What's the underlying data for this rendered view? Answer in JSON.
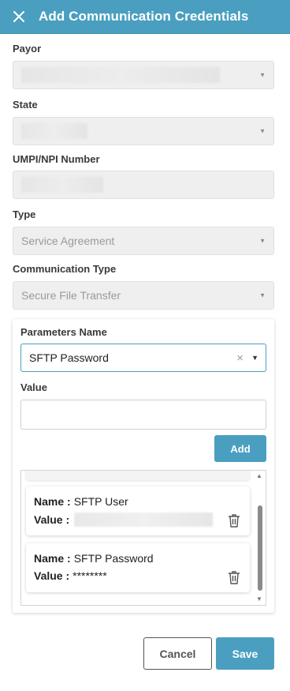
{
  "header": {
    "title": "Add Communication Credentials",
    "close_icon": "close-icon"
  },
  "form": {
    "payor_label": "Payor",
    "payor_value": "",
    "state_label": "State",
    "state_value": "",
    "npi_label": "UMPI/NPI Number",
    "npi_value": "",
    "type_label": "Type",
    "type_value": "Service Agreement",
    "comm_type_label": "Communication Type",
    "comm_type_value": "Secure File Transfer"
  },
  "parameters": {
    "name_label": "Parameters Name",
    "name_value": "SFTP Password",
    "value_label": "Value",
    "value_value": "",
    "add_label": "Add",
    "items": [
      {
        "name_key": "Name :",
        "name": "SFTP User",
        "value_key": "Value :",
        "value": ""
      },
      {
        "name_key": "Name :",
        "name": "SFTP Password",
        "value_key": "Value :",
        "value": "********"
      }
    ]
  },
  "footer": {
    "cancel_label": "Cancel",
    "save_label": "Save"
  },
  "colors": {
    "accent": "#4a9fc0",
    "disabled_field": "#efefef"
  }
}
